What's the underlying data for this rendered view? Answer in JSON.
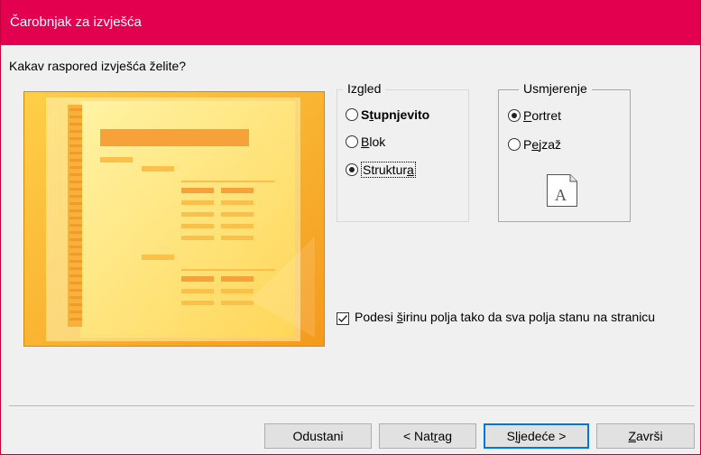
{
  "window": {
    "title": "Čarobnjak za izvješća"
  },
  "question": "Kakav raspored izvješća želite?",
  "layout_group": {
    "legend": "Izgled",
    "options": [
      {
        "pre": "S",
        "key": "t",
        "post": "upnjevito",
        "checked": false
      },
      {
        "pre": "",
        "key": "B",
        "post": "lok",
        "checked": false
      },
      {
        "pre": "Struktur",
        "key": "a",
        "post": "",
        "checked": true
      }
    ]
  },
  "orientation_group": {
    "legend": "Usmjerenje",
    "options": [
      {
        "pre": "",
        "key": "P",
        "post": "ortret",
        "checked": true
      },
      {
        "pre": "P",
        "key": "e",
        "post": "jzaž",
        "checked": false
      }
    ],
    "page_icon": {
      "icon": "portrait-page-icon",
      "letter": "A"
    }
  },
  "fit_checkbox": {
    "checked": true,
    "pre": "Podesi ",
    "key": "š",
    "post": "irinu polja tako da sva polja stanu na stranicu"
  },
  "buttons": {
    "cancel": {
      "pre": "Odustani",
      "key": "",
      "post": ""
    },
    "back": {
      "pre": "< Nat",
      "key": "r",
      "post": "ag"
    },
    "next": {
      "pre": "S",
      "key": "l",
      "post": "jedeće >"
    },
    "finish": {
      "pre": "",
      "key": "Z",
      "post": "avrši"
    }
  },
  "colors": {
    "titlebar": "#e3004f",
    "accent": "#0078d7",
    "preview": "#f5a623"
  }
}
